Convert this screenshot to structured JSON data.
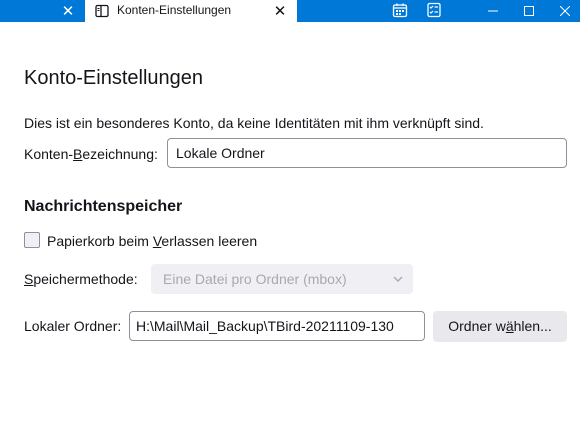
{
  "tabbar": {
    "active_tab_title": "Konten-Einstellungen",
    "close_glyph": "✕"
  },
  "icons": {
    "tab_icon": "sidebar-panel-icon",
    "toolbar": [
      "calendar-icon",
      "tasks-icon"
    ],
    "window_controls": [
      "minimize-icon",
      "maximize-icon",
      "close-icon"
    ]
  },
  "colors": {
    "titlebar": "#0078d7",
    "text": "#15141a",
    "disabled_text": "#a8a8af",
    "field_border": "#8f8f9d"
  },
  "page": {
    "title": "Konto-Einstellungen",
    "description": "Dies ist ein besonderes Konto, da keine Identitäten mit ihm verknüpft sind.",
    "account_name": {
      "label_pre": "Konten-",
      "label_key": "B",
      "label_post": "ezeichnung:",
      "value": "Lokale Ordner"
    },
    "storage": {
      "heading": "Nachrichtenspeicher",
      "empty_trash": {
        "label_pre": "Papierkorb beim ",
        "label_key": "V",
        "label_post": "erlassen leeren",
        "checked": false
      },
      "method": {
        "label_key": "S",
        "label_post": "peichermethode:",
        "selected": "Eine Datei pro Ordner (mbox)",
        "disabled": true
      },
      "local_folder": {
        "label": "Lokaler Ordner:",
        "value": "H:\\Mail\\Mail_Backup\\TBird-20211109-130",
        "button_pre": "Ordner w",
        "button_key": "ä",
        "button_post": "hlen..."
      }
    }
  }
}
